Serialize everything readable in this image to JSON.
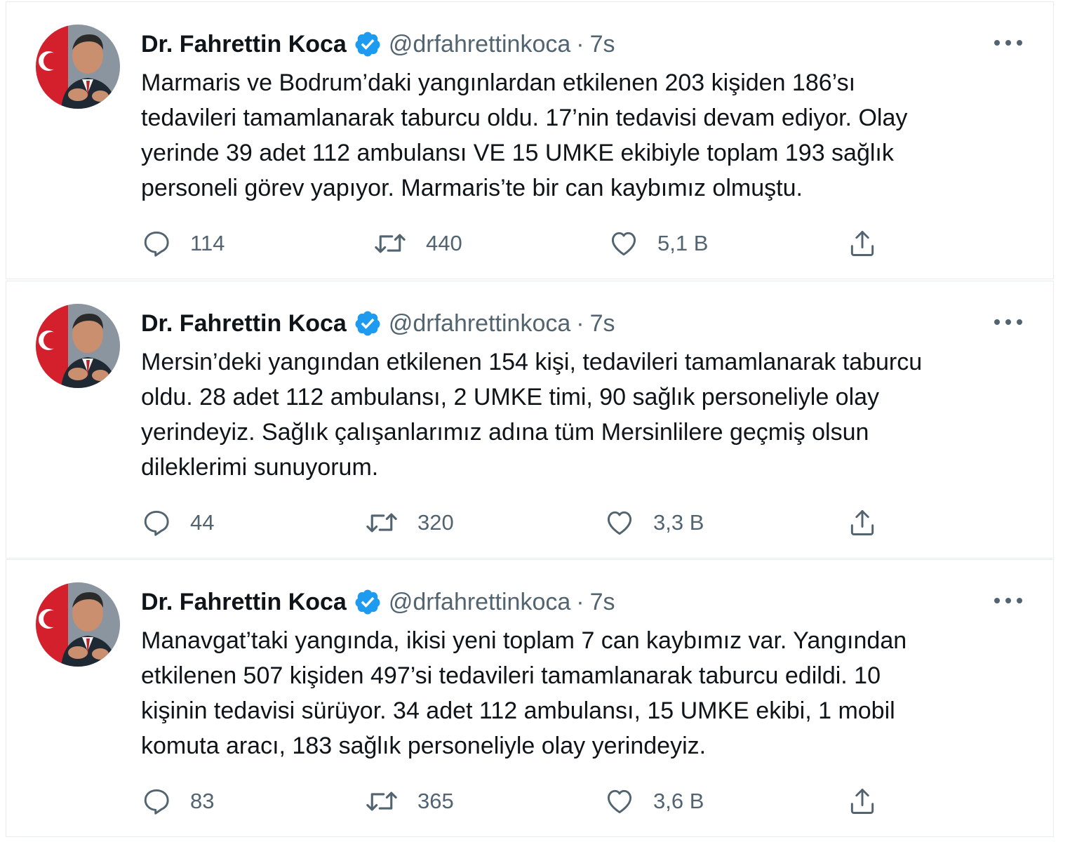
{
  "colors": {
    "verified_badge": "#1d9bf0",
    "secondary_text": "#536471",
    "primary_text": "#0f1419",
    "border": "#e6ecf0"
  },
  "icons": {
    "reply": "speech-bubble-icon",
    "retweet": "retweet-arrows-icon",
    "like": "heart-icon",
    "share": "share-upload-icon",
    "more": "more-dots-icon",
    "verified": "verified-badge-icon"
  },
  "tweets": [
    {
      "author": {
        "name": "Dr. Fahrettin Koca",
        "handle": "@drfahrettinkoca"
      },
      "separator": "·",
      "time": "7s",
      "text_lines": [
        "Marmaris ve Bodrum’daki yangınlardan etkilenen 203 kişiden 186’sı",
        "tedavileri tamamlanarak taburcu oldu. 17’nin tedavisi devam ediyor. Olay",
        "yerinde 39 adet 112 ambulansı VE 15 UMKE ekibiyle toplam 193 sağlık",
        "personeli görev yapıyor. Marmaris’te bir can kaybımız olmuştu."
      ],
      "stats": {
        "replies": "114",
        "retweets": "440",
        "likes": "5,1 B"
      }
    },
    {
      "author": {
        "name": "Dr. Fahrettin Koca",
        "handle": "@drfahrettinkoca"
      },
      "separator": "·",
      "time": "7s",
      "text_lines": [
        "Mersin’deki yangından etkilenen 154 kişi, tedavileri tamamlanarak taburcu",
        "oldu. 28 adet 112 ambulansı, 2 UMKE timi, 90 sağlık personeliyle olay",
        "yerindeyiz. Sağlık çalışanlarımız adına tüm Mersinlilere geçmiş olsun",
        "dileklerimi sunuyorum."
      ],
      "stats": {
        "replies": "44",
        "retweets": "320",
        "likes": "3,3 B"
      }
    },
    {
      "author": {
        "name": "Dr. Fahrettin Koca",
        "handle": "@drfahrettinkoca"
      },
      "separator": "·",
      "time": "7s",
      "text_lines": [
        "Manavgat’taki yangında, ikisi yeni toplam 7 can kaybımız var. Yangından",
        "etkilenen 507 kişiden 497’si tedavileri tamamlanarak taburcu edildi. 10",
        "kişinin tedavisi sürüyor. 34 adet 112 ambulansı, 15 UMKE ekibi, 1 mobil",
        "komuta aracı, 183 sağlık personeliyle olay yerindeyiz."
      ],
      "stats": {
        "replies": "83",
        "retweets": "365",
        "likes": "3,6 B"
      }
    }
  ]
}
